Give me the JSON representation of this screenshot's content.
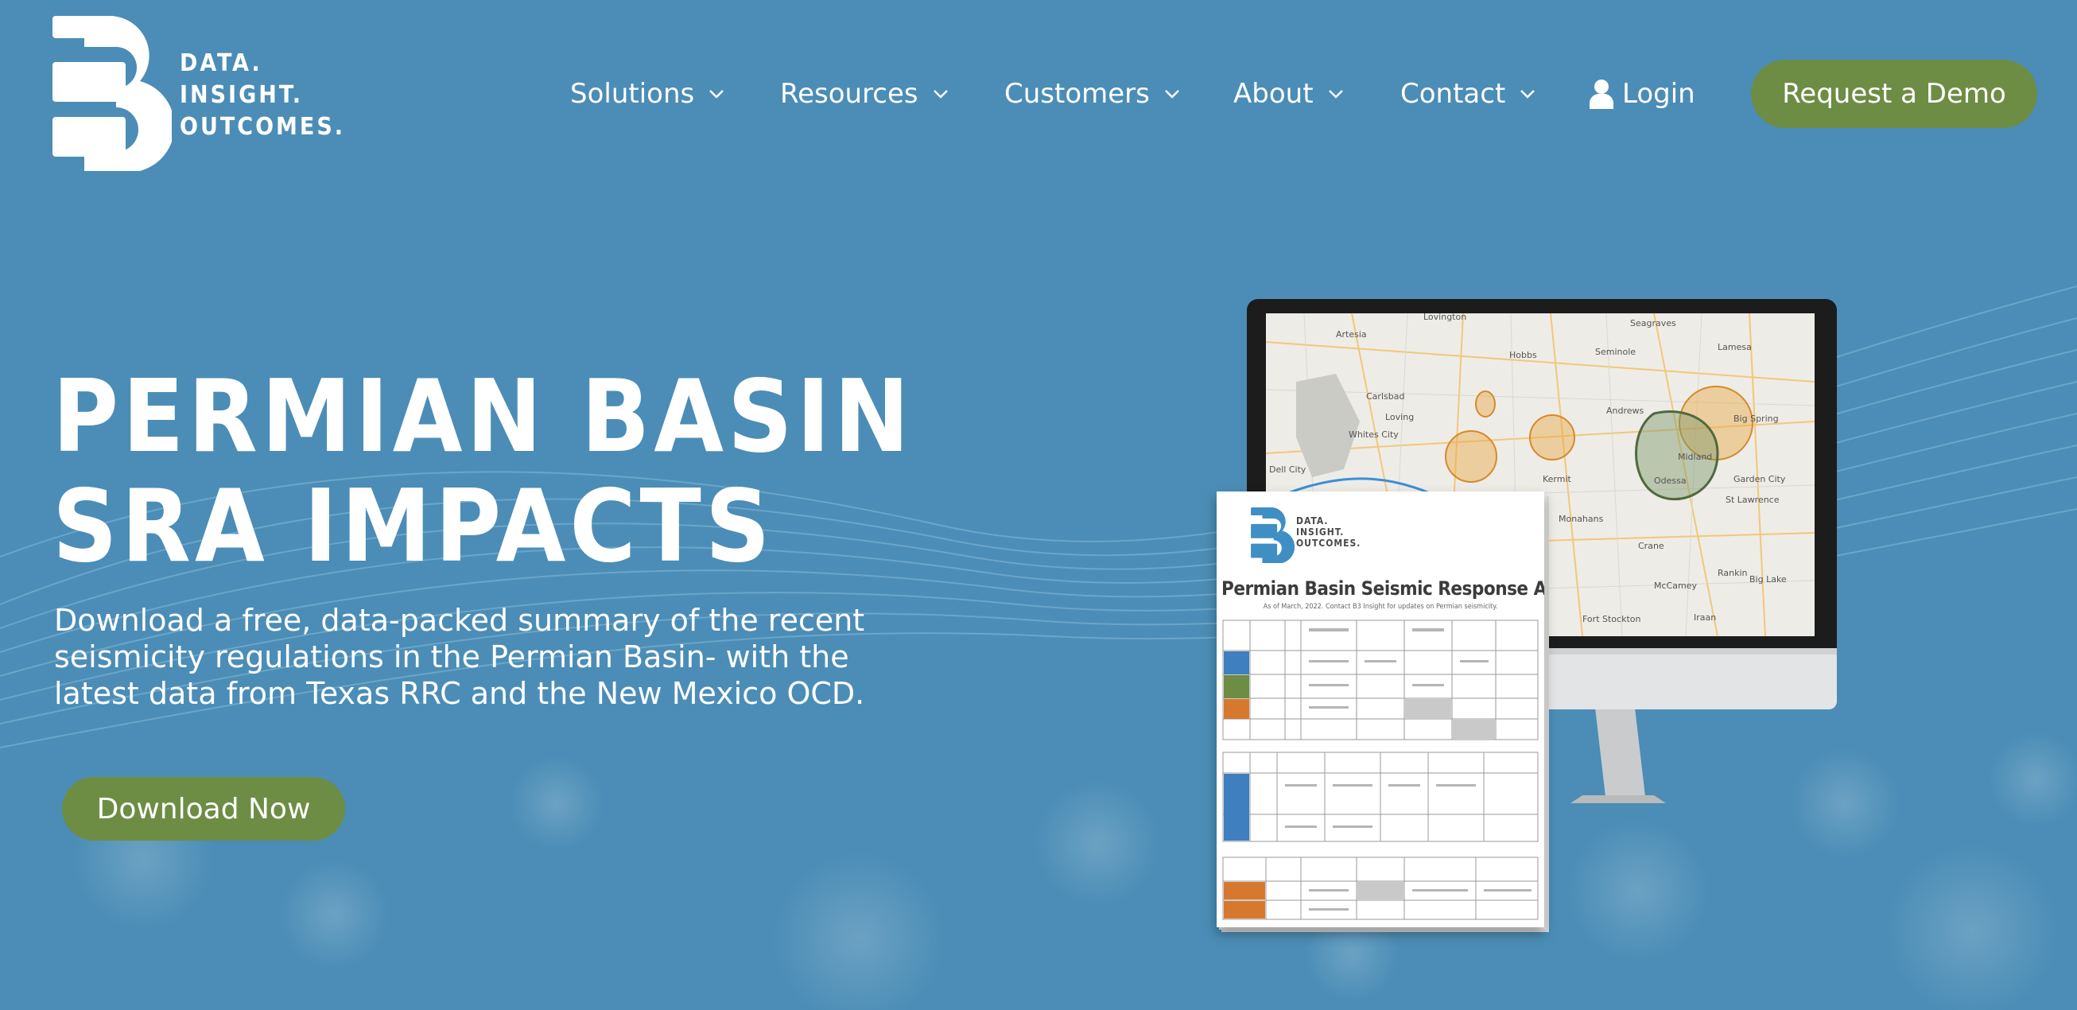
{
  "brand": {
    "tagline": "DATA.\nINSIGHT.\nOUTCOMES."
  },
  "nav": {
    "items": [
      {
        "label": "Solutions"
      },
      {
        "label": "Resources"
      },
      {
        "label": "Customers"
      },
      {
        "label": "About"
      },
      {
        "label": "Contact"
      }
    ],
    "login": "Login",
    "cta": "Request a Demo"
  },
  "hero": {
    "title": "PERMIAN BASIN SRA IMPACTS",
    "description": "Download a free, data-packed summary of the recent seismicity regulations in the Permian Basin- with the latest data from Texas RRC and the New Mexico OCD.",
    "button": "Download Now"
  },
  "document": {
    "logo_text": "DATA.\nINSIGHT.\nOUTCOMES.",
    "title": "Permian Basin Seismic Response Area Impacts",
    "subtitle": "As of March, 2022. Contact B3 Insight for updates on Permian seismicity."
  },
  "map": {
    "place_labels": [
      "Lovington",
      "Seagraves",
      "Lamesa",
      "Hobbs",
      "Seminole",
      "Artesia",
      "Carlsbad",
      "Loving",
      "Whites City",
      "Andrews",
      "Big Spring",
      "Midland",
      "Odessa",
      "Garden City",
      "St Lawrence",
      "Kermit",
      "Monahans",
      "Crane",
      "McCamey",
      "Rankin",
      "Big Lake",
      "Fort Stockton",
      "Iraan",
      "Dell City"
    ]
  },
  "colors": {
    "background": "#4b8db6",
    "accent_green": "#6d8d45",
    "text": "#ffffff"
  }
}
